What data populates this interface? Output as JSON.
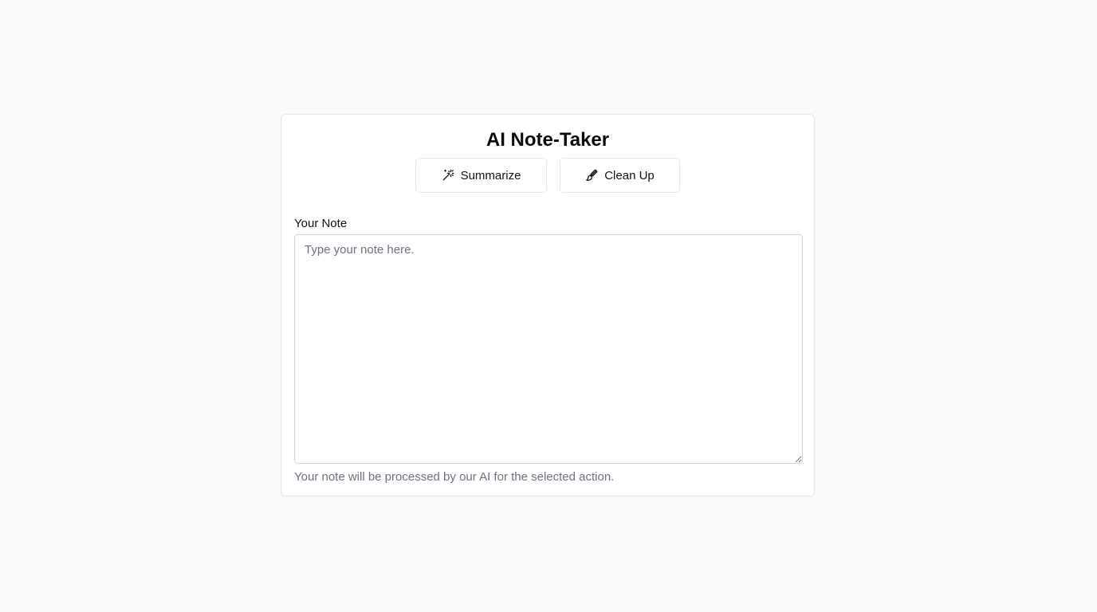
{
  "app": {
    "title": "AI Note-Taker"
  },
  "actions": {
    "summarize": {
      "label": "Summarize",
      "icon": "magic-wand-icon"
    },
    "clean_up": {
      "label": "Clean Up",
      "icon": "brush-icon"
    }
  },
  "note": {
    "label": "Your Note",
    "value": "",
    "placeholder": "Type your note here.",
    "helper": "Your note will be processed by our AI for the selected action."
  },
  "colors": {
    "background": "#f9fafb",
    "card": "#ffffff",
    "border": "#e5e7eb",
    "text": "#111111",
    "muted": "#6b7280"
  }
}
